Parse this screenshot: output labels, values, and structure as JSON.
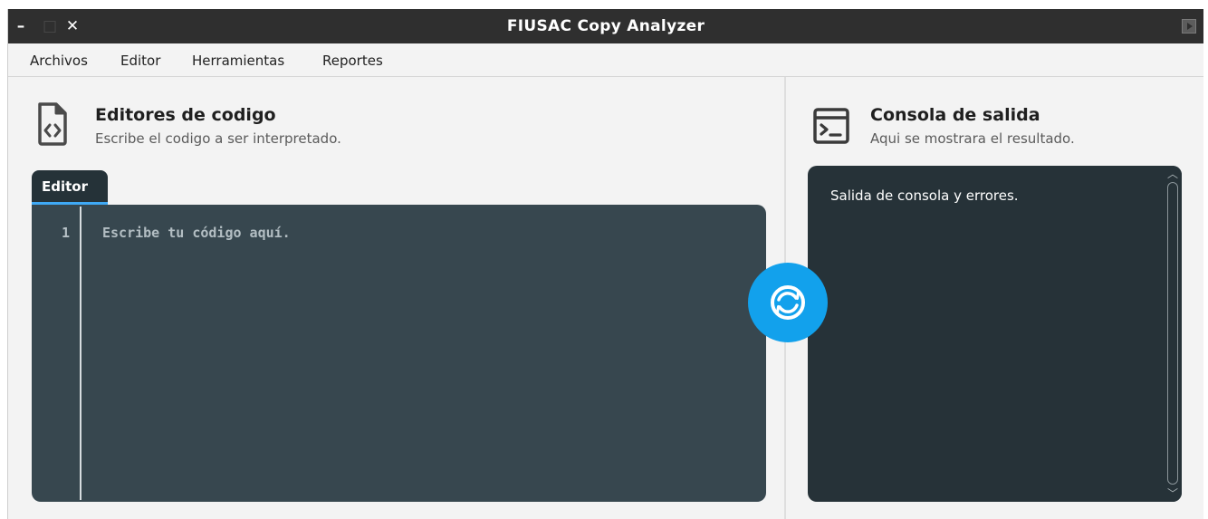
{
  "window": {
    "title": "FIUSAC Copy Analyzer",
    "minimize_glyph": "–",
    "maximize_glyph": "□",
    "close_glyph": "✕"
  },
  "menu": {
    "items": [
      {
        "label": "Archivos"
      },
      {
        "label": "Editor"
      },
      {
        "label": "Herramientas"
      },
      {
        "label": "Reportes"
      }
    ]
  },
  "editor_section": {
    "title": "Editores de codigo",
    "subtitle": "Escribe el codigo a ser interpretado.",
    "icon": "code-file-icon",
    "tab_label": "Editor",
    "line_number": "1",
    "placeholder": "Escribe tu código aquí."
  },
  "console_section": {
    "title": "Consola de salida",
    "subtitle": "Aqui se mostrara el resultado.",
    "icon": "terminal-icon",
    "output_text": "Salida de consola y errores."
  },
  "run_button": {
    "icon": "refresh-icon"
  },
  "colors": {
    "titlebar": "#2f2f2f",
    "editor_bg": "#37474f",
    "console_bg": "#263238",
    "accent": "#12a1ec"
  }
}
